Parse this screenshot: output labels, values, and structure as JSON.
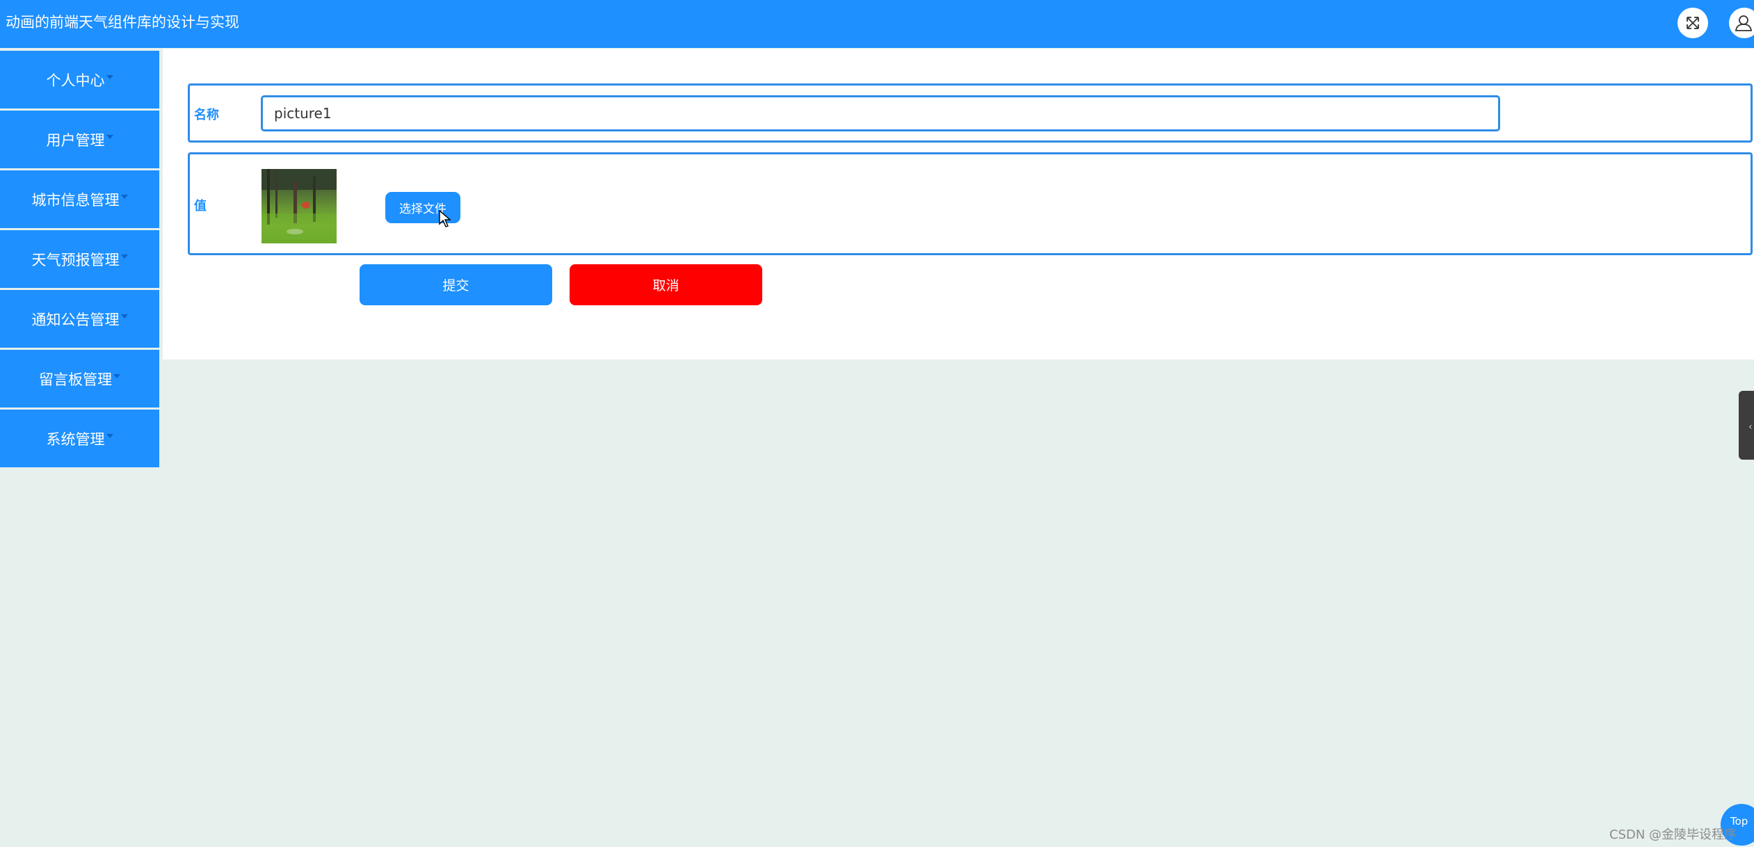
{
  "header": {
    "title": "动画的前端天气组件库的设计与实现",
    "fullscreen_icon": "fullscreen-icon",
    "user_icon": "user-icon"
  },
  "sidebar": {
    "items": [
      {
        "label": "个人中心"
      },
      {
        "label": "用户管理"
      },
      {
        "label": "城市信息管理"
      },
      {
        "label": "天气预报管理"
      },
      {
        "label": "通知公告管理"
      },
      {
        "label": "留言板管理"
      },
      {
        "label": "系统管理"
      }
    ]
  },
  "form": {
    "name_label": "名称",
    "name_value": "picture1",
    "value_label": "值",
    "choose_file_label": "选择文件",
    "submit_label": "提交",
    "cancel_label": "取消"
  },
  "floating": {
    "top_label": "Top",
    "watermark": "CSDN @金陵毕设程序"
  },
  "colors": {
    "primary": "#1e90ff",
    "danger": "#ff0000",
    "background": "#e6f0ec"
  }
}
